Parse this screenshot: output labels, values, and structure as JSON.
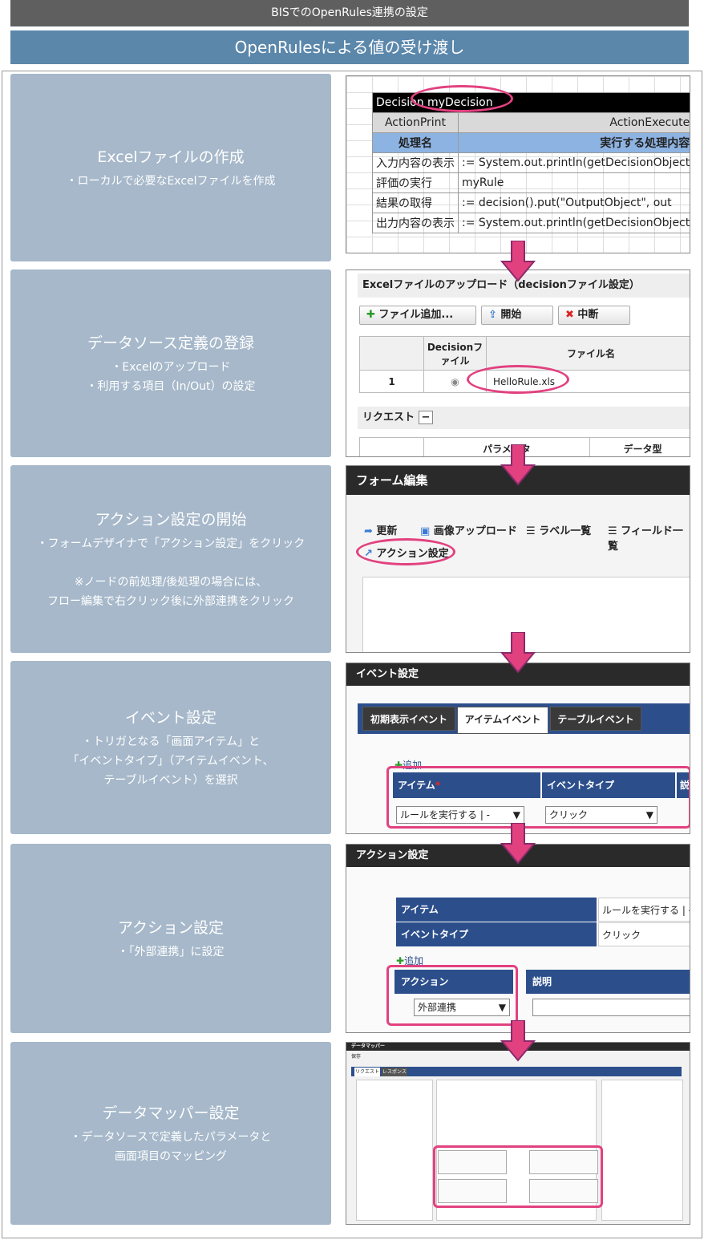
{
  "header": {
    "title": "BISでのOpenRules連携の設定",
    "subtitle": "OpenRulesによる値の受け渡し"
  },
  "steps": [
    {
      "title": "Excelファイルの作成",
      "desc": "・ローカルで必要なExcelファイルを作成"
    },
    {
      "title": "データソース定義の登録",
      "desc": "・Excelのアップロード\n・利用する項目（In/Out）の設定"
    },
    {
      "title": "アクション設定の開始",
      "desc": "・フォームデザイナで「アクション設定」をクリック\n\n※ノードの前処理/後処理の場合には、\nフロー編集で右クリック後に外部連携をクリック"
    },
    {
      "title": "イベント設定",
      "desc": "・トリガとなる「画面アイテム」と\n「イベントタイプ」（アイテムイベント、\nテーブルイベント）を選択"
    },
    {
      "title": "アクション設定",
      "desc": "・「外部連携」に設定"
    },
    {
      "title": "データマッパー設定",
      "desc": "・データソースで定義したパラメータと\n画面項目のマッピング"
    }
  ],
  "excel": {
    "decision_row": "Decision myDecision",
    "col1": "ActionPrint",
    "col2": "ActionExecute",
    "h1": "処理名",
    "h2": "実行する処理内容",
    "rows": [
      [
        "入力内容の表示",
        ":= System.out.println(getDecisionObject"
      ],
      [
        "評価の実行",
        "myRule"
      ],
      [
        "結果の取得",
        ":= decision().put(\"OutputObject\", out"
      ],
      [
        "出力内容の表示",
        ":= System.out.println(getDecisionObject"
      ]
    ]
  },
  "upload": {
    "title": "Excelファイルのアップロード（decisionファイル設定）",
    "add": "ファイル追加...",
    "start": "開始",
    "stop": "中断",
    "col_decision": "Decisionファイル",
    "col_file": "ファイル名",
    "row_no": "1",
    "file": "HelloRule.xls",
    "request": "リクエスト",
    "param": "パラメータ",
    "datatype": "データ型"
  },
  "form": {
    "title": "フォーム編集",
    "update": "更新",
    "image_upload": "画像アップロード",
    "label_list": "ラベル一覧",
    "field_list": "フィールド一覧",
    "action_setting": "アクション設定"
  },
  "event": {
    "title": "イベント設定",
    "tab1": "初期表示イベント",
    "tab2": "アイテムイベント",
    "tab3": "テーブルイベント",
    "add": "追加",
    "item": "アイテム",
    "required": "*",
    "event_type": "イベントタイプ",
    "item_value": "ルールを実行する | -",
    "type_value": "クリック",
    "desc": "説"
  },
  "action": {
    "title": "アクション設定",
    "item": "アイテム",
    "item_value": "ルールを実行する | -",
    "event_type": "イベントタイプ",
    "type_value": "クリック",
    "add": "追加",
    "action": "アクション",
    "desc": "説明",
    "action_value": "外部連携"
  },
  "mapper": {
    "title": "データマッパー",
    "save": "保存",
    "tab_req": "リクエスト",
    "tab_res": "レスポンス"
  },
  "colors": {
    "accent": "#e2417f",
    "arrow": "#e2417f",
    "step_bg": "#a6b8ca"
  }
}
